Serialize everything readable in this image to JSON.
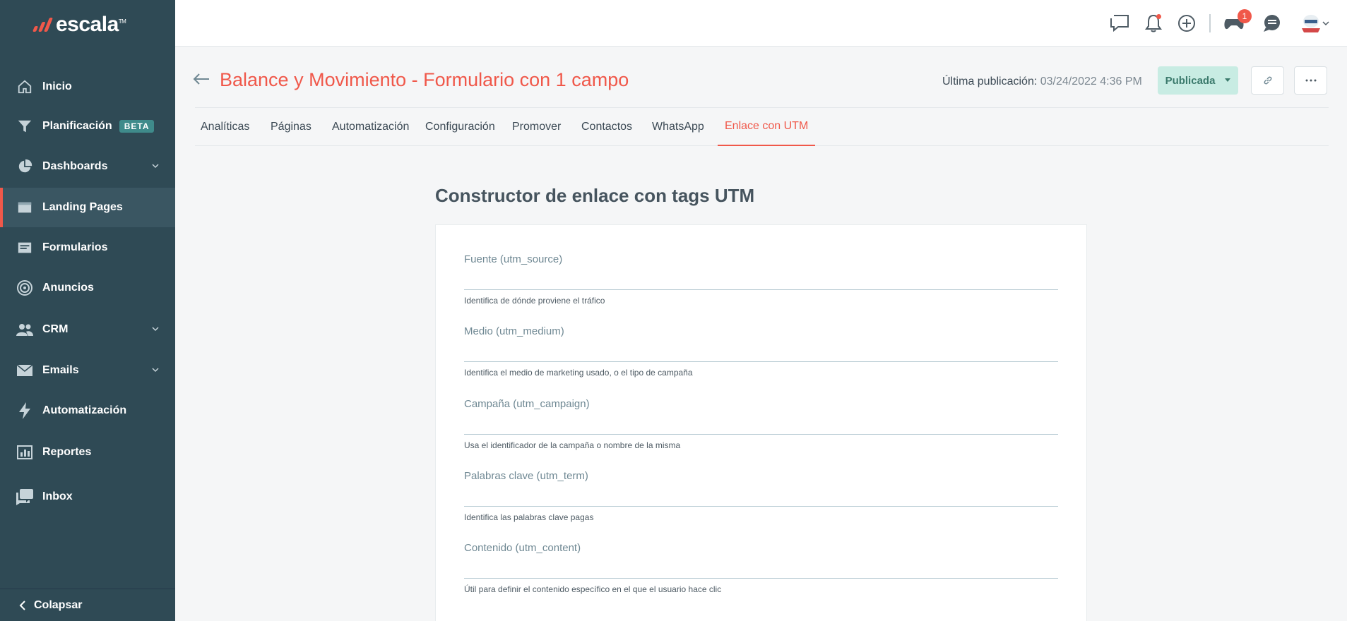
{
  "app": {
    "logo_text": "escala",
    "logo_mark": "TM"
  },
  "sidebar": {
    "items": [
      {
        "label": "Inicio",
        "icon": "home-icon"
      },
      {
        "label": "Planificación",
        "icon": "funnel-icon",
        "badge": "BETA"
      },
      {
        "label": "Dashboards",
        "icon": "pie-chart-icon",
        "expandable": true
      },
      {
        "label": "Landing Pages",
        "icon": "browser-window-icon",
        "active": true
      },
      {
        "label": "Formularios",
        "icon": "form-icon"
      },
      {
        "label": "Anuncios",
        "icon": "target-icon"
      },
      {
        "label": "CRM",
        "icon": "people-icon",
        "expandable": true
      },
      {
        "label": "Emails",
        "icon": "envelope-icon",
        "expandable": true
      },
      {
        "label": "Automatización",
        "icon": "lightning-icon"
      },
      {
        "label": "Reportes",
        "icon": "bar-chart-icon"
      },
      {
        "label": "Inbox",
        "icon": "chat-bubbles-icon"
      }
    ],
    "collapse_label": "Colapsar"
  },
  "topbar": {
    "icons": [
      "chat-feedback-icon",
      "bell-icon",
      "plus-circle-icon",
      "gamepad-icon",
      "support-chat-icon",
      "avatar"
    ],
    "gamepad_badge": "1"
  },
  "header": {
    "title": "Balance y Movimiento - Formulario con 1 campo",
    "last_pub_label": "Última publicación:",
    "last_pub_value": "03/24/2022 4:36 PM",
    "status_label": "Publicada"
  },
  "tabs": [
    {
      "label": "Analíticas"
    },
    {
      "label": "Páginas"
    },
    {
      "label": "Automatización"
    },
    {
      "label": "Configuración"
    },
    {
      "label": "Promover"
    },
    {
      "label": "Contactos"
    },
    {
      "label": "WhatsApp"
    },
    {
      "label": "Enlace con UTM",
      "active": true
    }
  ],
  "utm": {
    "title": "Constructor de enlace con tags UTM",
    "fields": [
      {
        "label": "Fuente (utm_source)",
        "value": "",
        "help": "Identifica de dónde proviene el tráfico"
      },
      {
        "label": "Medio (utm_medium)",
        "value": "",
        "help": "Identifica el medio de marketing usado, o el tipo de campaña"
      },
      {
        "label": "Campaña (utm_campaign)",
        "value": "",
        "help": "Usa el identificador de la campaña o nombre de la misma"
      },
      {
        "label": "Palabras clave (utm_term)",
        "value": "",
        "help": "Identifica las palabras clave pagas"
      },
      {
        "label": "Contenido (utm_content)",
        "value": "",
        "help": "Útil para definir el contenido específico en el que el usuario hace clic"
      }
    ]
  },
  "colors": {
    "sidebar": "#2f4a55",
    "accent": "#f0584a",
    "status_bg": "#c8ece3"
  }
}
